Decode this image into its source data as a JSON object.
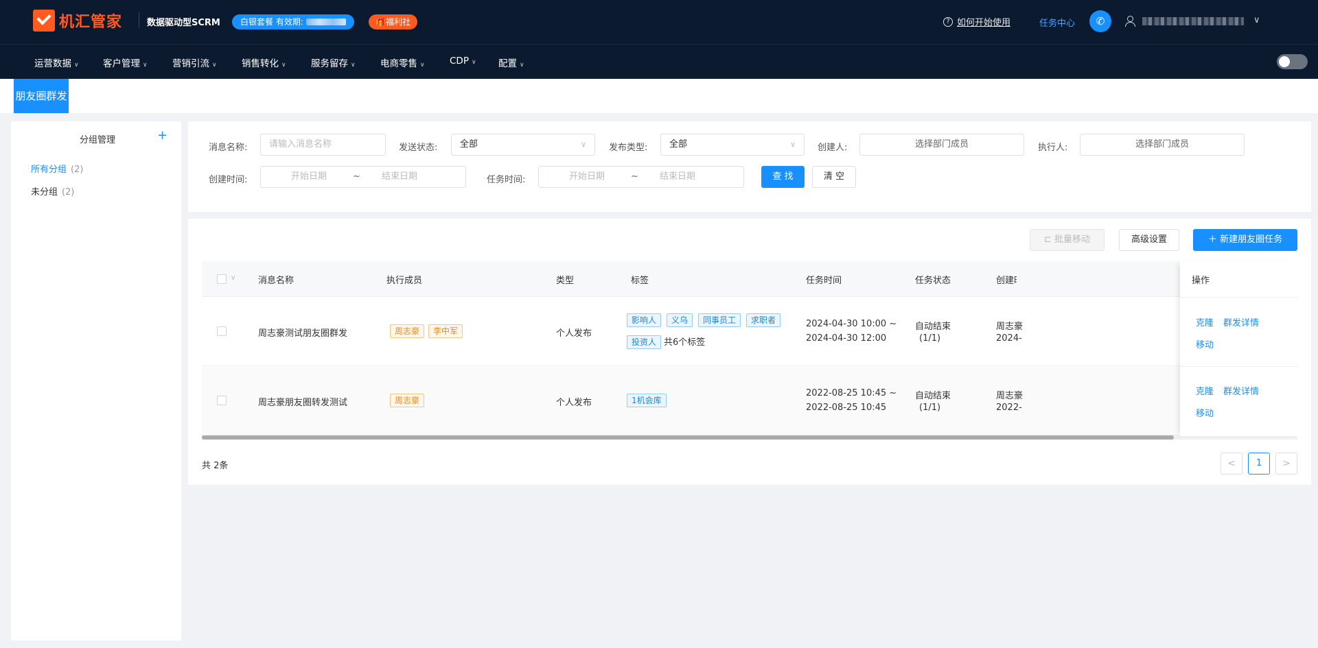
{
  "header": {
    "logo_text": "机汇管家",
    "subtitle": "数据驱动型SCRM",
    "plan_badge": "白银套餐 有效期:",
    "welfare_badge": "🎁福利社",
    "help_link": "如何开始使用",
    "task_center": "任务中心",
    "user_caret": "∨"
  },
  "nav": {
    "items": [
      "运营数据",
      "客户管理",
      "营销引流",
      "销售转化",
      "服务留存",
      "电商零售",
      "CDP",
      "配置"
    ]
  },
  "page_tab": "朋友圈群发",
  "left_panel": {
    "title": "分组管理",
    "add_symbol": "+",
    "groups": [
      {
        "label": "所有分组",
        "count": "(2)",
        "active_color": "#1890ff"
      },
      {
        "label": "未分组",
        "count": "(2)"
      }
    ]
  },
  "filters": {
    "message_name_label": "消息名称:",
    "message_name_placeholder": "请输入消息名称",
    "send_status_label": "发送状态:",
    "send_status_value": "全部",
    "publish_type_label": "发布类型:",
    "publish_type_value": "全部",
    "creator_label": "创建人:",
    "creator_value": "选择部门成员",
    "executor_label": "执行人:",
    "executor_value": "选择部门成员",
    "create_time_label": "创建时间:",
    "task_time_label": "任务时间:",
    "start_date": "开始日期",
    "end_date": "结束日期",
    "range_sep": "~",
    "search_button": "查 找",
    "clear_button": "清 空"
  },
  "toolbar": {
    "batch_move": "批量移动",
    "advanced": "高级设置",
    "new_task": "新建朋友圈任务"
  },
  "table": {
    "columns": [
      "消息名称",
      "执行成员",
      "类型",
      "标签",
      "任务时间",
      "任务状态",
      "创建时",
      "操作"
    ],
    "rows": [
      {
        "name": "周志豪测试朋友圈群发",
        "members": [
          "周志豪",
          "李中军"
        ],
        "type": "个人发布",
        "tags_line1": [
          "影响人",
          "义乌",
          "同事员工",
          "求职者"
        ],
        "tags_line2": [
          "投资人"
        ],
        "tags_total": "共6个标签",
        "time_line1": "2024-04-30 10:00 ~",
        "time_line2": "2024-04-30 12:00",
        "status_line1": "自动结束",
        "status_line2": "(1/1)",
        "creator_line1": "周志豪",
        "creator_line2": "2024-",
        "ops": [
          "克隆",
          "群发详情",
          "移动"
        ]
      },
      {
        "name": "周志豪朋友圈转发测试",
        "members": [
          "周志豪"
        ],
        "type": "个人发布",
        "tags_line1": [
          "1机会库"
        ],
        "tags_line2": [],
        "tags_total": "",
        "time_line1": "2022-08-25 10:45 ~",
        "time_line2": "2022-08-25 10:45",
        "status_line1": "自动结束",
        "status_line2": "(1/1)",
        "creator_line1": "周志豪",
        "creator_line2": "2022-",
        "ops": [
          "克隆",
          "群发详情",
          "移动"
        ]
      }
    ]
  },
  "footer": {
    "total": "共 2条",
    "current_page": "1",
    "prev": "<",
    "next": ">"
  },
  "colors": {
    "primary": "#1890ff",
    "brand_orange": "#ff5a1f",
    "header_bg": "#0b1a2f"
  }
}
